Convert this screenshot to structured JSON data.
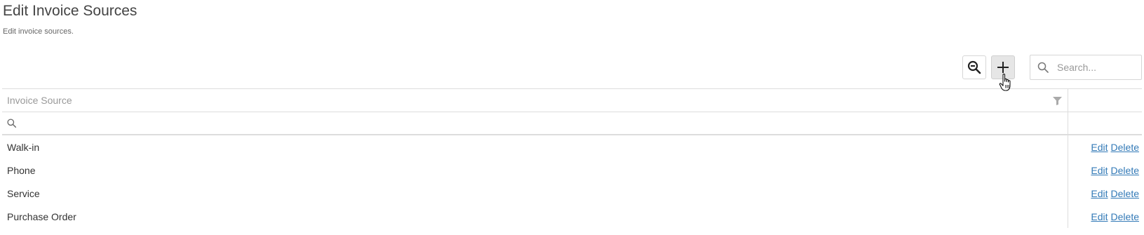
{
  "page": {
    "title": "Edit Invoice Sources",
    "subtitle": "Edit invoice sources."
  },
  "toolbar": {
    "zoom_icon": "zoom-out-icon",
    "add_icon": "plus-icon"
  },
  "search": {
    "placeholder": "Search...",
    "value": ""
  },
  "grid": {
    "columns": [
      "Invoice Source",
      ""
    ],
    "filter_icon": "filter-icon",
    "filter_row_icon": "search-icon",
    "rows": [
      {
        "source": "Walk-in",
        "edit": "Edit",
        "delete": "Delete"
      },
      {
        "source": "Phone",
        "edit": "Edit",
        "delete": "Delete"
      },
      {
        "source": "Service",
        "edit": "Edit",
        "delete": "Delete"
      },
      {
        "source": "Purchase Order",
        "edit": "Edit",
        "delete": "Delete"
      }
    ]
  },
  "colors": {
    "link": "#337ab7",
    "border": "#dddddd",
    "header_text": "#999999"
  }
}
